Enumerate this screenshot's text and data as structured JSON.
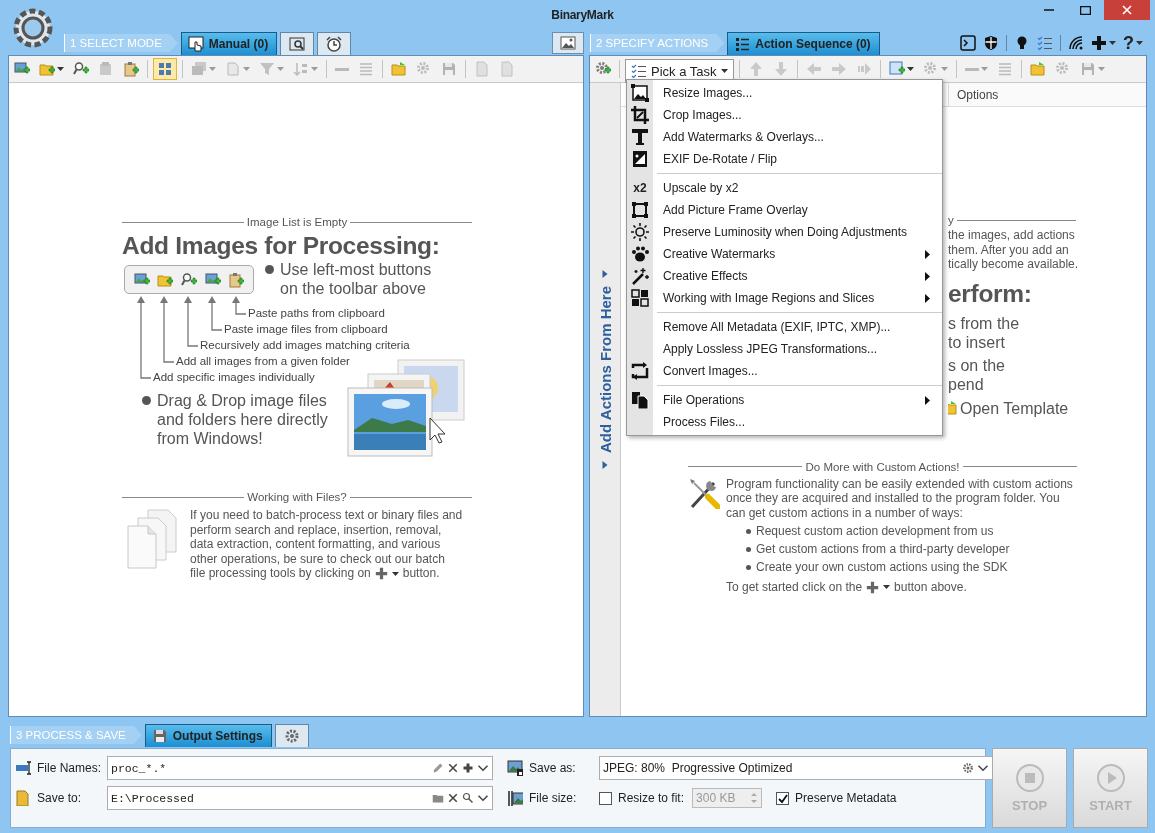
{
  "window": {
    "title": "BinaryMark"
  },
  "mode_bar": {
    "step": "1 SELECT MODE",
    "tabs": [
      {
        "kind": "text",
        "label": "Manual (0)",
        "selected": true
      },
      {
        "kind": "icon",
        "selected": false
      },
      {
        "kind": "icon",
        "selected": false
      }
    ]
  },
  "actions_bar": {
    "step": "2 SPECIFY ACTIONS",
    "tabs": [
      {
        "kind": "text",
        "label": "Action Sequence (0)",
        "selected": true
      }
    ],
    "help_label": "?"
  },
  "left_toolbar": [
    {
      "kind": "image-add",
      "disabled": false,
      "dropdown": false,
      "selected": false
    },
    {
      "kind": "folder-add",
      "disabled": false,
      "dropdown": true,
      "selected": false
    },
    {
      "kind": "search-add",
      "disabled": false,
      "dropdown": false,
      "selected": false
    },
    {
      "kind": "paste-image",
      "disabled": true,
      "dropdown": false,
      "selected": false
    },
    {
      "kind": "paste-add",
      "disabled": false,
      "dropdown": false,
      "selected": false
    },
    {
      "kind": "separator"
    },
    {
      "kind": "grid",
      "disabled": false,
      "dropdown": false,
      "selected": true
    },
    {
      "kind": "separator"
    },
    {
      "kind": "images",
      "disabled": true,
      "dropdown": true,
      "selected": false
    },
    {
      "kind": "pages",
      "disabled": true,
      "dropdown": true,
      "selected": false
    },
    {
      "kind": "filter",
      "disabled": true,
      "dropdown": true,
      "selected": false
    },
    {
      "kind": "sort",
      "disabled": true,
      "dropdown": true,
      "selected": false
    },
    {
      "kind": "separator"
    },
    {
      "kind": "minus",
      "disabled": true,
      "dropdown": false,
      "selected": false
    },
    {
      "kind": "list",
      "disabled": true,
      "dropdown": false,
      "selected": false
    },
    {
      "kind": "separator"
    },
    {
      "kind": "folder",
      "disabled": false,
      "dropdown": false,
      "selected": false
    },
    {
      "kind": "gear",
      "disabled": true,
      "dropdown": false,
      "selected": false
    },
    {
      "kind": "save",
      "disabled": true,
      "dropdown": false,
      "selected": false
    },
    {
      "kind": "separator"
    },
    {
      "kind": "document",
      "disabled": true,
      "dropdown": false,
      "selected": false
    },
    {
      "kind": "document",
      "disabled": true,
      "dropdown": false,
      "selected": false
    }
  ],
  "image_list": {
    "section_title": "Image List is Empty",
    "heading": "Add Images for Processing:",
    "tip_1": "Use left-most buttons on the toolbar above",
    "callouts": [
      "Paste paths from clipboard",
      "Paste image files from clipboard",
      "Recursively add images matching criteria",
      "Add all images from a given folder",
      "Add specific images individually"
    ],
    "tip_2": "Drag & Drop image files and folders here directly from Windows!"
  },
  "files_help": {
    "title": "Working with Files?",
    "text": "If you need to batch-process text or binary files and perform search and replace, insertion, removal, data extraction, content formatting, and various other operations, be sure to check out our batch",
    "text_last": "file processing tools by clicking on",
    "text_end": "button."
  },
  "right_toolbar": [
    {
      "kind": "gear-add",
      "disabled": false,
      "dropdown": false
    },
    {
      "kind": "separator"
    },
    {
      "kind": "task-picker",
      "label": "Pick a Task",
      "expanded": true
    },
    {
      "kind": "separator"
    },
    {
      "kind": "arrow-up",
      "disabled": true,
      "dropdown": false
    },
    {
      "kind": "arrow-down",
      "disabled": true,
      "dropdown": false
    },
    {
      "kind": "separator"
    },
    {
      "kind": "arrow-left",
      "disabled": true,
      "dropdown": false
    },
    {
      "kind": "arrow-right",
      "disabled": true,
      "dropdown": false
    },
    {
      "kind": "arrow-end",
      "disabled": true,
      "dropdown": false
    },
    {
      "kind": "separator"
    },
    {
      "kind": "square-add",
      "disabled": false,
      "dropdown": true
    },
    {
      "kind": "gear",
      "disabled": true,
      "dropdown": true
    },
    {
      "kind": "separator"
    },
    {
      "kind": "minus",
      "disabled": true,
      "dropdown": true
    },
    {
      "kind": "list",
      "disabled": true,
      "dropdown": false
    },
    {
      "kind": "separator"
    },
    {
      "kind": "folder",
      "disabled": false,
      "dropdown": false
    },
    {
      "kind": "gear",
      "disabled": true,
      "dropdown": false
    },
    {
      "kind": "save",
      "disabled": true,
      "dropdown": true
    }
  ],
  "actions": {
    "sidebar_label": "Add Actions From Here",
    "columns": [
      "Options"
    ],
    "covered_intro": {
      "title_end": "y",
      "lines": [
        "the images, add actions",
        "them. After you add an",
        "tically become available."
      ],
      "heading_end": "erform:",
      "tip_1_lines": [
        "s from the",
        "to insert"
      ],
      "tip_2_lines": [
        "s on the",
        "pend"
      ],
      "open_template": "Open Template"
    }
  },
  "custom_actions": {
    "title": "Do More with Custom Actions!",
    "text": "Program functionality can be easily extended with custom actions once they are acquired and installed to the program folder. You can get custom actions in a number of ways:",
    "ways": [
      "Request custom action development from us",
      "Get custom actions from a third-party developer",
      "Create your own custom actions using the SDK"
    ],
    "footer_start": "To get started click on the",
    "footer_end": "button above."
  },
  "task_menu": {
    "groups": [
      {
        "items": [
          {
            "kind": "resize",
            "label": "Resize Images...",
            "submenu": false
          },
          {
            "kind": "crop",
            "label": "Crop Images...",
            "submenu": false
          },
          {
            "kind": "text",
            "label": "Add Watermarks & Overlays...",
            "submenu": false
          },
          {
            "kind": "rotate",
            "label": "EXIF De-Rotate / Flip",
            "submenu": false
          }
        ]
      },
      {
        "items": [
          {
            "kind": "glyph",
            "icon_text": "x2",
            "label": "Upscale by x2",
            "submenu": false
          },
          {
            "kind": "frame",
            "label": "Add Picture Frame Overlay",
            "submenu": false
          },
          {
            "kind": "sun",
            "label": "Preserve Luminosity when Doing Adjustments",
            "submenu": false
          },
          {
            "kind": "paw",
            "label": "Creative Watermarks",
            "submenu": true
          },
          {
            "kind": "wand",
            "label": "Creative Effects",
            "submenu": true
          },
          {
            "kind": "regions",
            "label": "Working with Image Regions and Slices",
            "submenu": true
          }
        ]
      },
      {
        "items": [
          {
            "kind": "none",
            "label": "Remove All Metadata (EXIF, IPTC, XMP)...",
            "submenu": false
          },
          {
            "kind": "none",
            "label": "Apply Lossless JPEG Transformations...",
            "submenu": false
          },
          {
            "kind": "convert",
            "label": "Convert Images...",
            "submenu": false
          }
        ]
      },
      {
        "items": [
          {
            "kind": "files",
            "label": "File Operations",
            "submenu": true
          },
          {
            "kind": "none",
            "label": "Process Files...",
            "submenu": false
          }
        ]
      }
    ]
  },
  "process_bar": {
    "step": "3 PROCESS & SAVE",
    "tabs": [
      {
        "kind": "text",
        "label": "Output Settings",
        "selected": true
      },
      {
        "kind": "icon",
        "selected": false
      }
    ]
  },
  "output": {
    "file_names": {
      "label": "File Names:",
      "value": "proc_*.*"
    },
    "save_to": {
      "label": "Save to:",
      "value": "E:\\Processed"
    },
    "save_as": {
      "label": "Save as:",
      "value": "JPEG: 80%  Progressive Optimized"
    },
    "file_size": {
      "label": "File size:",
      "resize": {
        "label": "Resize to fit:",
        "checked": false
      },
      "size": {
        "value": "300 KB",
        "disabled": true
      },
      "preserve": {
        "label": "Preserve Metadata",
        "checked": true
      }
    }
  },
  "run_buttons": [
    {
      "kind": "stop",
      "label": "STOP",
      "disabled": true
    },
    {
      "kind": "start",
      "label": "START",
      "disabled": true
    }
  ]
}
